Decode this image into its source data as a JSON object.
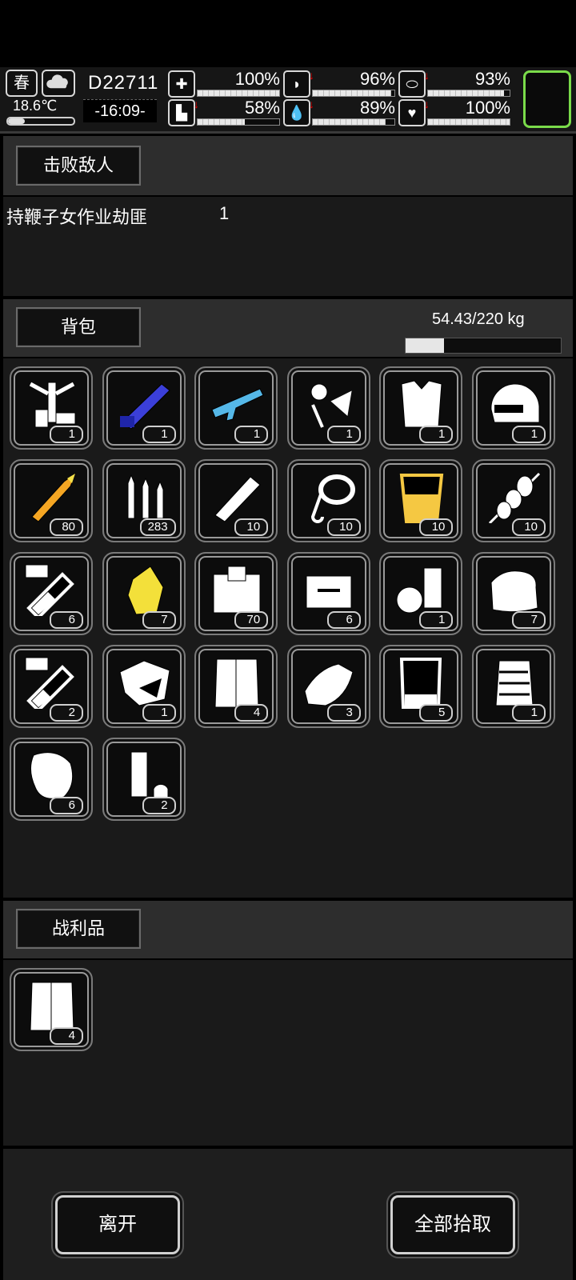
{
  "status": {
    "season": "春",
    "temperature": "18.6℃",
    "temperature_level": 0.25,
    "day_code": "D22711",
    "time": "-16:09-",
    "stats": [
      {
        "icon": "medkit-icon",
        "value": "100%",
        "level": 1.0,
        "down": false
      },
      {
        "icon": "stomach-icon",
        "value": "96%",
        "level": 0.96,
        "down": true
      },
      {
        "icon": "pill-icon",
        "value": "93%",
        "level": 0.93,
        "down": true
      },
      {
        "icon": "boot-icon",
        "value": "58%",
        "level": 0.58,
        "down": true
      },
      {
        "icon": "water-drop-icon",
        "value": "89%",
        "level": 0.89,
        "down": true
      },
      {
        "icon": "heart-icon",
        "value": "100%",
        "level": 1.0,
        "down": true
      }
    ],
    "arrow": "↓"
  },
  "defeated": {
    "title": "击败敌人",
    "enemy_name": "持鞭子女作业劫匪",
    "enemy_count": "1"
  },
  "backpack": {
    "title": "背包",
    "weight": "54.43/220 kg",
    "weight_level": 0.2474,
    "items": [
      {
        "icon": "exoskeleton-icon",
        "count": "1",
        "color": "#ffffff"
      },
      {
        "icon": "minigun-icon",
        "count": "1",
        "color": "#3b3fd9"
      },
      {
        "icon": "rifle-icon",
        "count": "1",
        "color": "#55b8e8"
      },
      {
        "icon": "scrap-parts-icon",
        "count": "1",
        "color": "#ffffff"
      },
      {
        "icon": "armor-vest-icon",
        "count": "1",
        "color": "#ffffff"
      },
      {
        "icon": "helmet-icon",
        "count": "1",
        "color": "#ffffff"
      },
      {
        "icon": "rocket-ammo-icon",
        "count": "80",
        "color": "#f5a623"
      },
      {
        "icon": "bullets-icon",
        "count": "283",
        "color": "#ffffff"
      },
      {
        "icon": "tube-icon",
        "count": "10",
        "color": "#ffffff"
      },
      {
        "icon": "rope-icon",
        "count": "10",
        "color": "#ffffff"
      },
      {
        "icon": "beer-glass-icon",
        "count": "10",
        "color": "#f5c842"
      },
      {
        "icon": "skewer-icon",
        "count": "10",
        "color": "#ffffff"
      },
      {
        "icon": "test-tube-vii-icon",
        "count": "6",
        "color": "#ffffff"
      },
      {
        "icon": "crystal-icon",
        "count": "7",
        "color": "#f3e03a"
      },
      {
        "icon": "crate-icon",
        "count": "70",
        "color": "#ffffff"
      },
      {
        "icon": "tool-kit-icon",
        "count": "6",
        "color": "#ffffff"
      },
      {
        "icon": "cans-icon",
        "count": "1",
        "color": "#ffffff"
      },
      {
        "icon": "cloth-icon",
        "count": "7",
        "color": "#ffffff"
      },
      {
        "icon": "test-tube-iii-icon",
        "count": "2",
        "color": "#ffffff"
      },
      {
        "icon": "ore-icon",
        "count": "1",
        "color": "#ffffff"
      },
      {
        "icon": "sheet-icon",
        "count": "4",
        "color": "#ffffff"
      },
      {
        "icon": "fabric-roll-icon",
        "count": "3",
        "color": "#ffffff"
      },
      {
        "icon": "beaker-icon",
        "count": "5",
        "color": "#ffffff"
      },
      {
        "icon": "fur-icon",
        "count": "1",
        "color": "#ffffff"
      },
      {
        "icon": "leather-icon",
        "count": "6",
        "color": "#ffffff"
      },
      {
        "icon": "battery-icon",
        "count": "2",
        "color": "#ffffff"
      }
    ]
  },
  "loot": {
    "title": "战利品",
    "items": [
      {
        "icon": "sheet-icon",
        "count": "4",
        "color": "#ffffff"
      }
    ]
  },
  "actions": {
    "leave": "离开",
    "pickup_all": "全部拾取"
  }
}
